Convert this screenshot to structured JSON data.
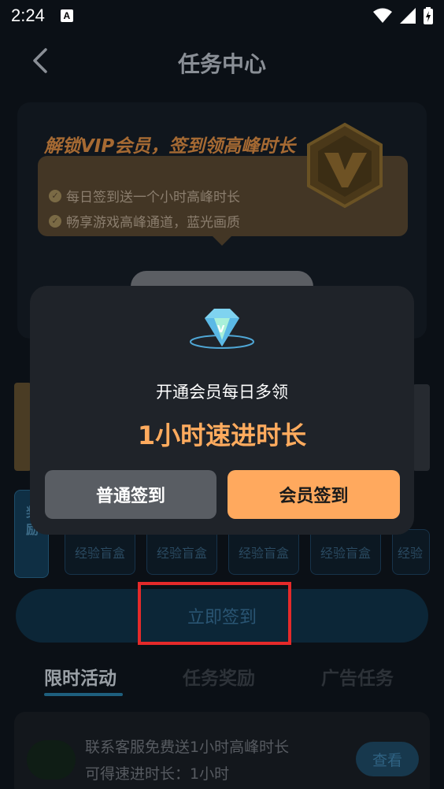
{
  "status_bar": {
    "time": "2:24",
    "notification_icon": "A"
  },
  "header": {
    "title": "任务中心"
  },
  "vip_card": {
    "heading": "解锁VIP会员，签到领高峰时长",
    "features": [
      "每日签到送一个小时高峰时长",
      "畅享游戏高峰通道，蓝光画质"
    ]
  },
  "rewards": {
    "label": "奖励",
    "boxes": [
      "经验盲盒",
      "经验盲盒",
      "经验盲盒",
      "经验盲盒",
      "经验"
    ]
  },
  "sign_button": {
    "label": "立即签到"
  },
  "tabs": [
    "限时活动",
    "任务奖励",
    "广告任务"
  ],
  "task": {
    "title": "联系客服免费送1小时高峰时长",
    "subtitle": "可得速进时长：1小时",
    "button": "查看"
  },
  "modal": {
    "line1": "开通会员每日多领",
    "line2": "1小时速进时长",
    "normal_button": "普通签到",
    "vip_button": "会员签到"
  },
  "colors": {
    "accent": "#ffa95e",
    "highlight": "#e52a2a"
  }
}
